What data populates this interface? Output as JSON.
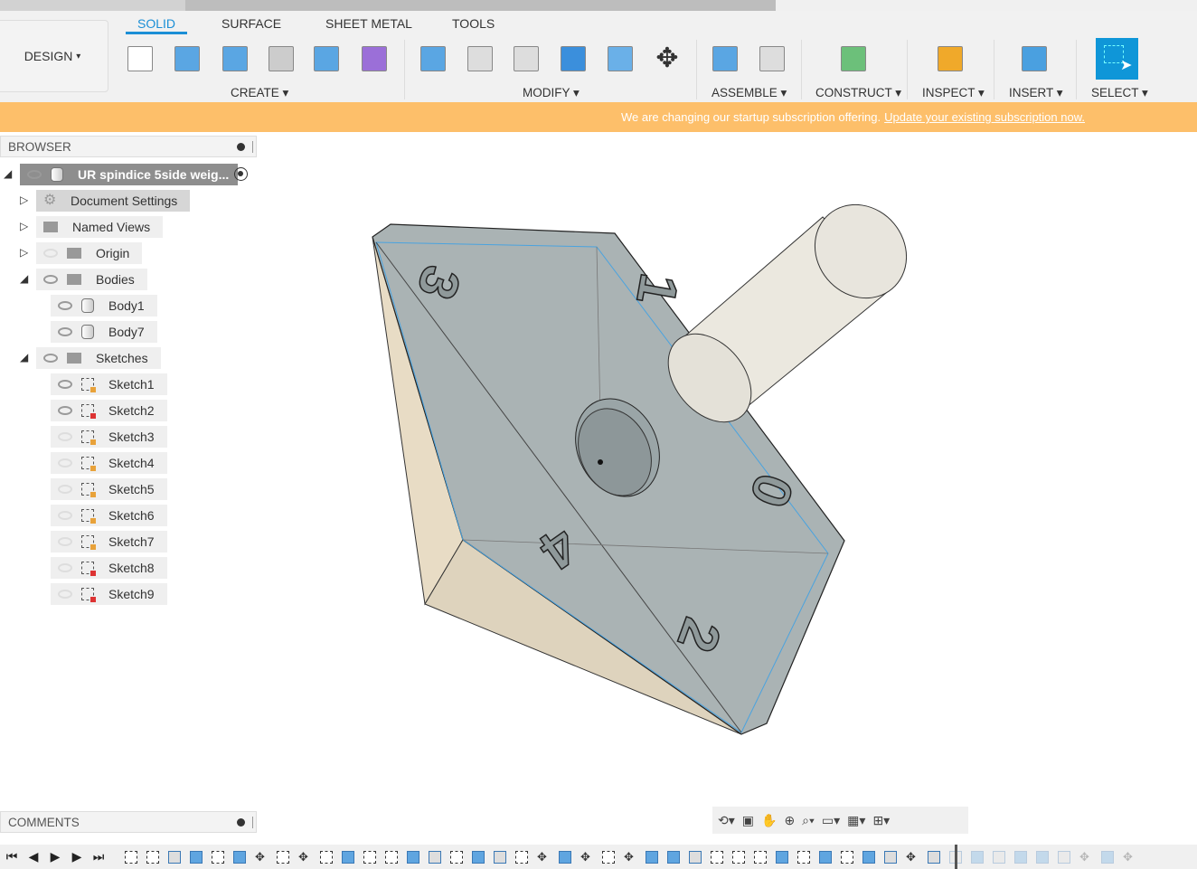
{
  "workspace": {
    "label": "DESIGN",
    "dropdown": "▾"
  },
  "tabs": [
    {
      "label": "SOLID",
      "active": true
    },
    {
      "label": "SURFACE"
    },
    {
      "label": "SHEET METAL"
    },
    {
      "label": "TOOLS"
    }
  ],
  "groups": [
    {
      "label": "CREATE ▾"
    },
    {
      "label": "MODIFY ▾"
    },
    {
      "label": "ASSEMBLE ▾"
    },
    {
      "label": "CONSTRUCT ▾"
    },
    {
      "label": "INSPECT ▾"
    },
    {
      "label": "INSERT ▾"
    },
    {
      "label": "SELECT ▾"
    }
  ],
  "tools": [
    "create-sketch",
    "extrude",
    "revolve",
    "hole",
    "pattern",
    "create-form",
    "press-pull",
    "fillet",
    "shell",
    "combine",
    "split-body",
    "move",
    "new-component",
    "joint",
    "offset-plane",
    "measure",
    "insert-image",
    "select"
  ],
  "banner": {
    "text": "We are changing our startup subscription offering.",
    "link": "Update your existing subscription now.",
    "color": "#fdbf6a"
  },
  "browser": {
    "title": "BROWSER",
    "root": "UR spindice 5side weig...",
    "items": [
      {
        "label": "Document Settings"
      },
      {
        "label": "Named Views"
      },
      {
        "label": "Origin"
      },
      {
        "label": "Bodies"
      },
      {
        "label": "Body1"
      },
      {
        "label": "Body7"
      },
      {
        "label": "Sketches"
      },
      {
        "label": "Sketch1"
      },
      {
        "label": "Sketch2"
      },
      {
        "label": "Sketch3"
      },
      {
        "label": "Sketch4"
      },
      {
        "label": "Sketch5"
      },
      {
        "label": "Sketch6"
      },
      {
        "label": "Sketch7"
      },
      {
        "label": "Sketch8"
      },
      {
        "label": "Sketch9"
      }
    ]
  },
  "comments": {
    "title": "COMMENTS"
  },
  "model": {
    "face_labels": [
      "3",
      "1",
      "4",
      "0",
      "2"
    ]
  },
  "navbar": {
    "icons": [
      "orbit",
      "look-at",
      "pan",
      "zoom",
      "fit",
      "display-settings",
      "grid",
      "viewports"
    ]
  },
  "timeline": {
    "controls": [
      "⏮",
      "◀",
      "▶",
      "▶",
      "⏭"
    ],
    "features": "ssfbsbmsmsbssbfsbfsmbmsmbbfsssbsbsbfmffbfbbfmbm",
    "suppressed_from": 38
  },
  "accent": "#1b8fd6"
}
